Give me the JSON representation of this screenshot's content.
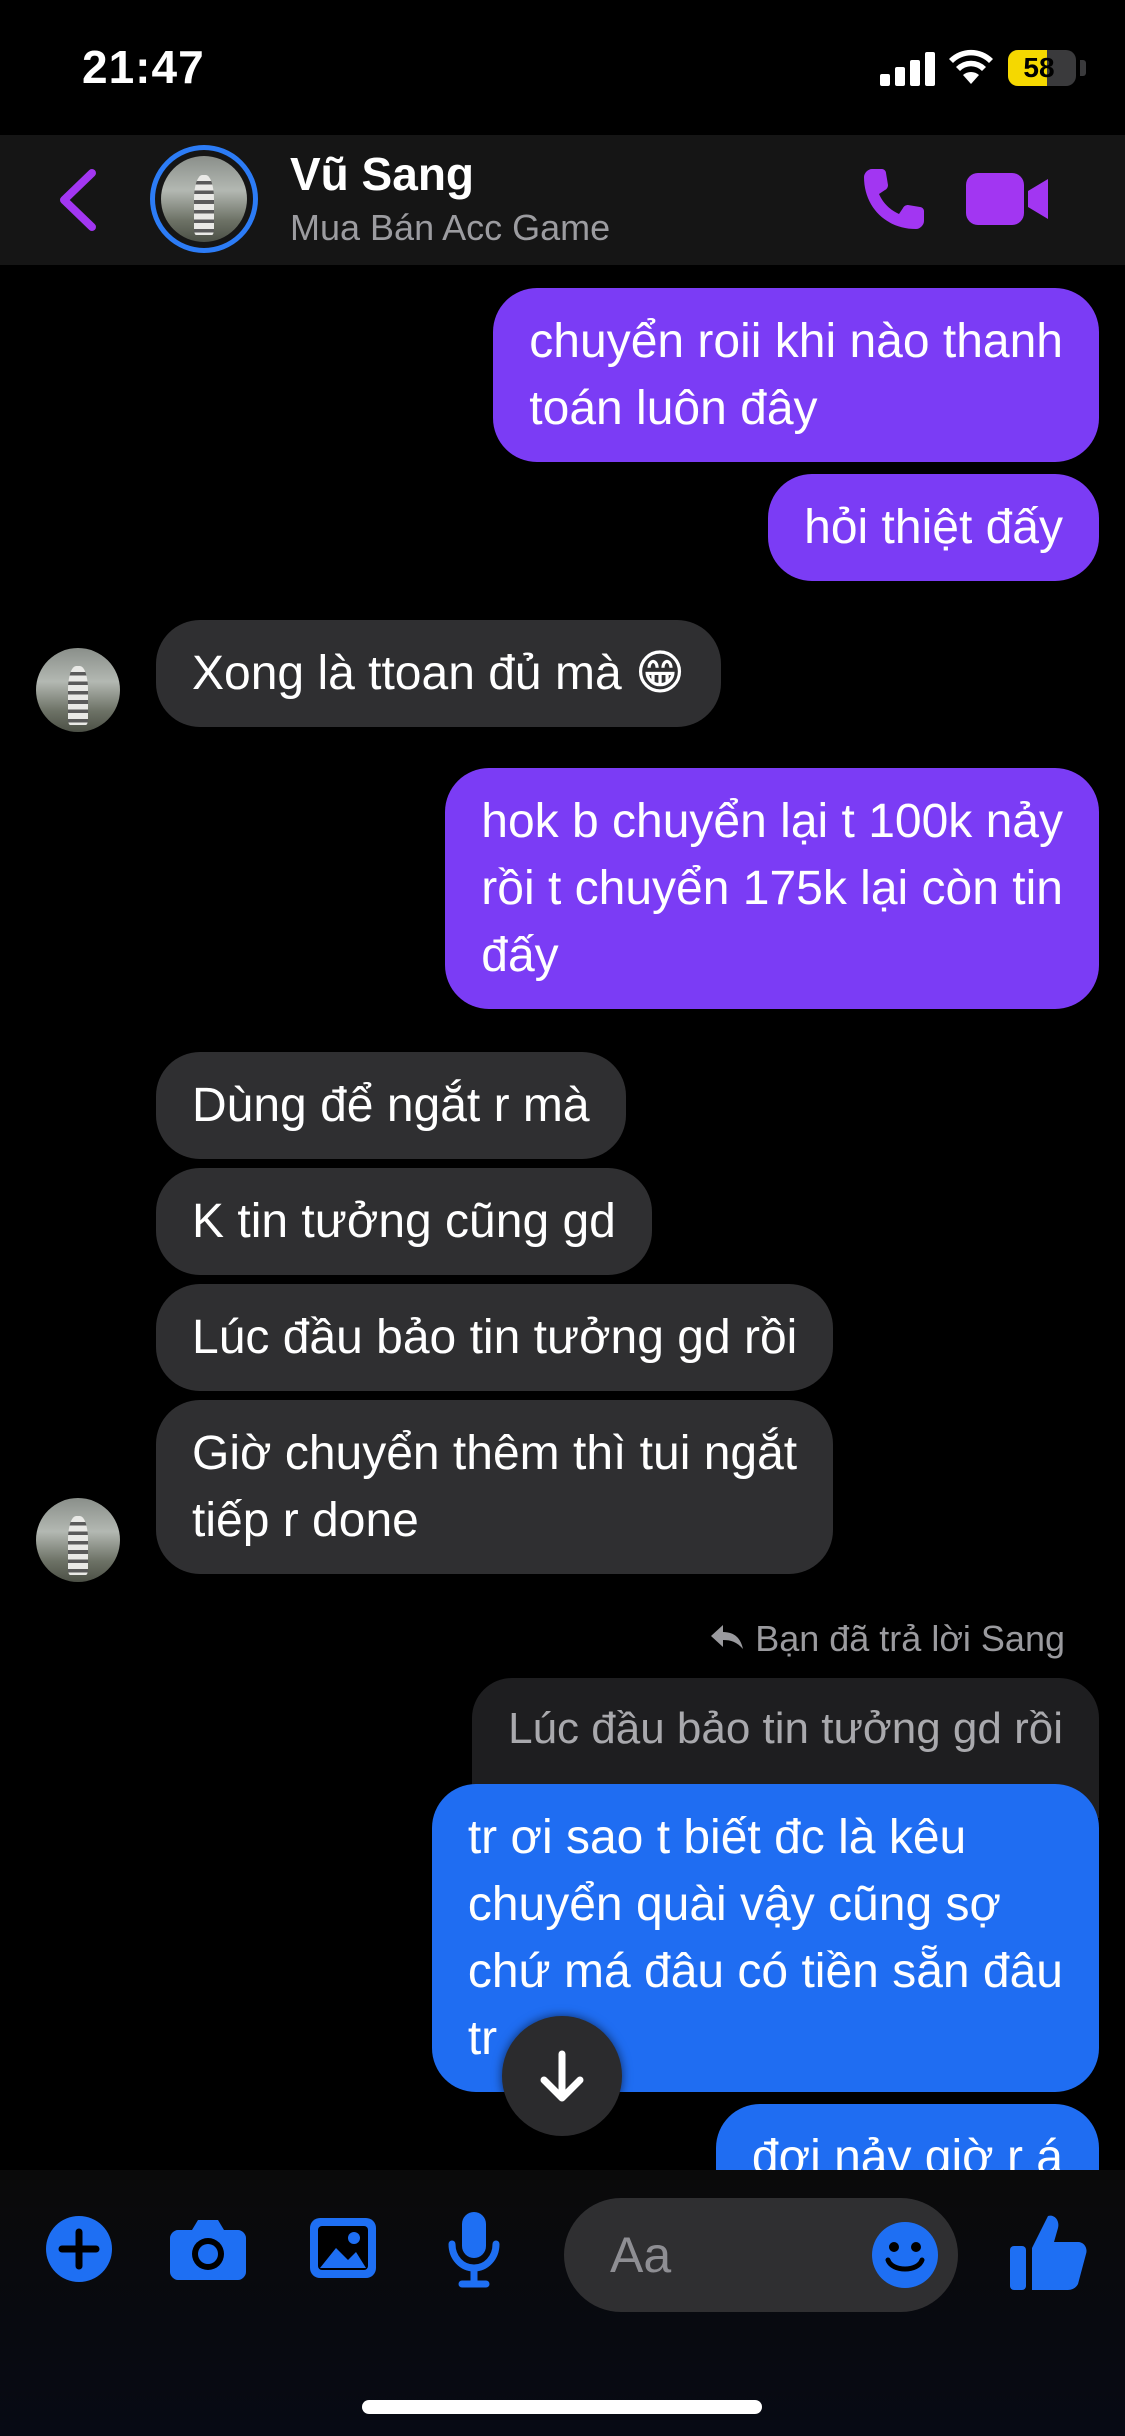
{
  "status_bar": {
    "time": "21:47",
    "battery": "58",
    "battery_level": 0.58
  },
  "header": {
    "name": "Vũ Sang",
    "subtitle": "Mua Bán Acc Game"
  },
  "messages": [
    {
      "text": "chuyển roii khi nào thanh\ntoán luôn đây"
    },
    {
      "text": "hỏi thiệt đấy"
    },
    {
      "text": "Xong là ttoan đủ mà 😁"
    },
    {
      "text": "hok b chuyển lại t 100k nảy\nrồi t chuyển 175k lại còn tin\nđấy"
    },
    {
      "text": "Dùng để ngắt r mà"
    },
    {
      "text": "K tin tưởng cũng gd"
    },
    {
      "text": "Lúc đầu bảo tin tưởng gd rồi"
    },
    {
      "text": "Giờ chuyển thêm thì tui ngắt\ntiếp r done"
    },
    {
      "text": "tr ơi sao t biết đc là kêu\nchuyển quài vậy cũng sợ\nchứ má đâu có tiền sẵn đâu\ntr"
    },
    {
      "text": "đợi nảy giờ r á"
    }
  ],
  "reply": {
    "label": "Bạn đã trả lời Sang",
    "quoted": "Lúc đầu bảo tin tưởng gd rồi"
  },
  "composer": {
    "placeholder": "Aa"
  },
  "colors": {
    "accent": "#a236f2",
    "outgoing": "#7b3cf5",
    "outgoing_blue": "#1f6df2",
    "incoming": "#2f2f31",
    "toolbar_icon": "#1e6ff3"
  },
  "icons": [
    "back-chevron-icon",
    "phone-icon",
    "video-camera-icon",
    "plus-icon",
    "camera-icon",
    "gallery-icon",
    "microphone-icon",
    "emoji-icon",
    "thumbs-up-icon",
    "arrow-down-icon",
    "reply-arrow-icon"
  ]
}
